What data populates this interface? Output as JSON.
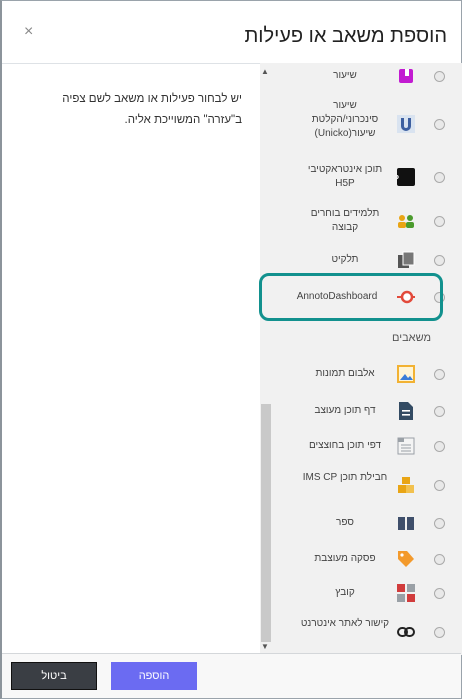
{
  "dialog": {
    "title": "הוספת משאב או פעילות",
    "close_glyph": "×",
    "help_text": "יש לבחור פעילות או משאב לשם צפיה ב\"עזרה\" המשוייכת אליה."
  },
  "activities": [
    {
      "label": "שיעור",
      "icon": "lesson-icon",
      "color": "#c21bd1"
    },
    {
      "label": "שיעור סינכרוני/הקלטת שיעור(Unicko)",
      "icon": "unicko-icon",
      "color": "#3d5fa0"
    },
    {
      "label": "תוכן אינטראקטיבי H5P",
      "icon": "h5p-icon",
      "color": "#111111"
    },
    {
      "label": "תלמידים בוחרים קבוצה",
      "icon": "group-choice-icon",
      "color": "#4b9b2d"
    },
    {
      "label": "תלקיט",
      "icon": "portfolio-icon",
      "color": "#444444"
    },
    {
      "label": "AnnotoDashboard",
      "icon": "annoto-icon",
      "color": "#e24a3b"
    }
  ],
  "resources_heading": "משאבים",
  "resources": [
    {
      "label": "אלבום תמונות",
      "icon": "photo-album-icon",
      "color": "#f2b233"
    },
    {
      "label": "דף תוכן מעוצב",
      "icon": "page-icon",
      "color": "#334b63"
    },
    {
      "label": "דפי תוכן בחוצצים",
      "icon": "tabbed-pages-icon",
      "color": "#9aa0a6"
    },
    {
      "label": "חבילת תוכן IMS CP",
      "icon": "ims-package-icon",
      "color": "#e9a515"
    },
    {
      "label": "ספר",
      "icon": "book-icon",
      "color": "#3f4f6b"
    },
    {
      "label": "פסקה מעוצבת",
      "icon": "label-tag-icon",
      "color": "#f39a2c"
    },
    {
      "label": "קובץ",
      "icon": "file-icon",
      "color": "#d13c3c"
    },
    {
      "label": "קישור לאתר אינטרנט",
      "icon": "url-link-icon",
      "color": "#222222"
    }
  ],
  "highlight_color": "#12918e",
  "buttons": {
    "add": "הוספה",
    "cancel": "ביטול"
  }
}
